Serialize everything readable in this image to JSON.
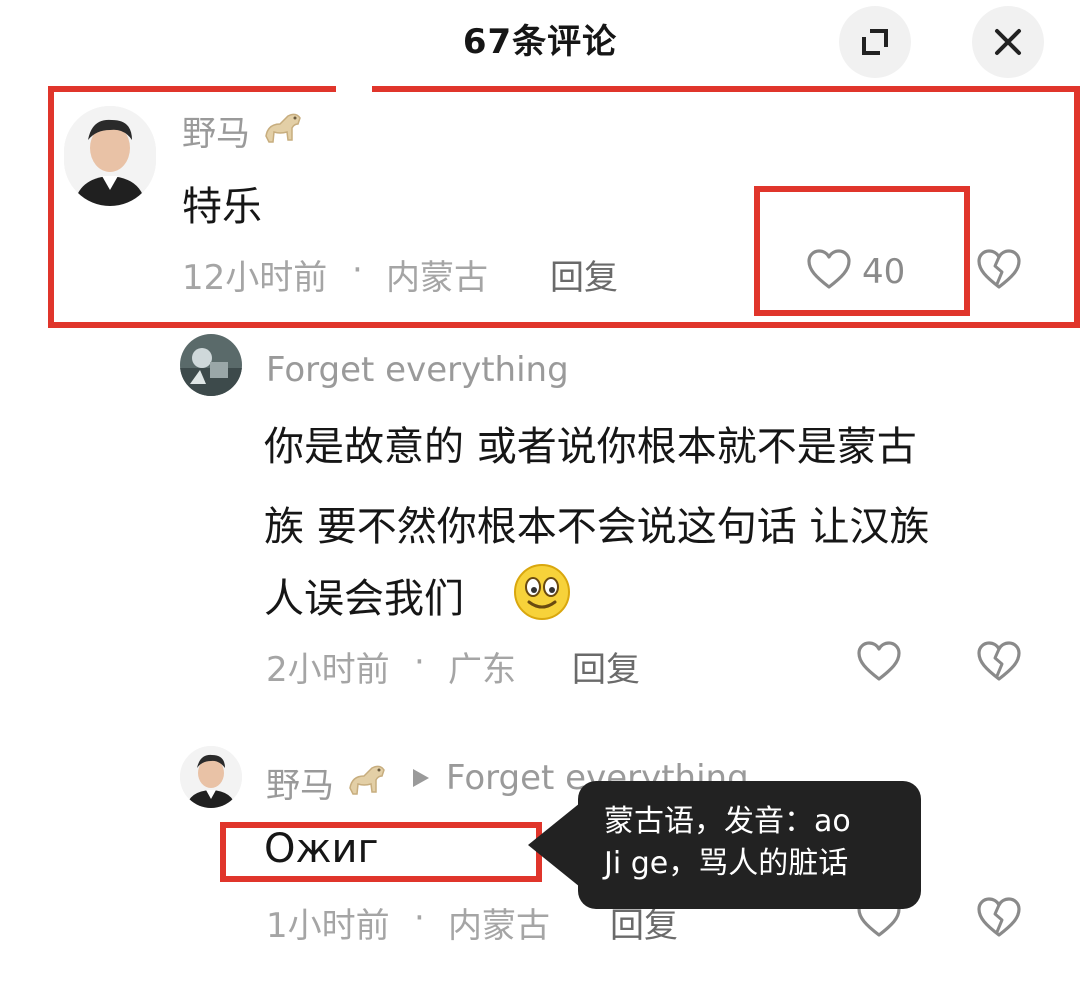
{
  "header": {
    "title": "67条评论"
  },
  "comments": [
    {
      "username": "野马",
      "username_emoji": "horse-icon",
      "text": "特乐",
      "time": "12小时前",
      "location": "内蒙古",
      "reply_label": "回复",
      "like_count": "40"
    },
    {
      "username": "Forget everything",
      "text_lines": [
        "你是故意的  或者说你根本就不是蒙古",
        "族  要不然你根本不会说这句话 让汉族",
        "人误会我们"
      ],
      "emoji": "smile-emoji",
      "time": "2小时前",
      "location": "广东",
      "reply_label": "回复"
    },
    {
      "username": "野马",
      "reply_to": "Forget everything",
      "text": "Ожиг",
      "time": "1小时前",
      "location": "内蒙古",
      "reply_label": "回复"
    }
  ],
  "tooltip": {
    "lines": [
      "蒙古语，发音：ao",
      "Ji ge，骂人的脏话"
    ]
  },
  "colors": {
    "annotation_red": "#e0352b",
    "tooltip_bg": "#222222"
  }
}
